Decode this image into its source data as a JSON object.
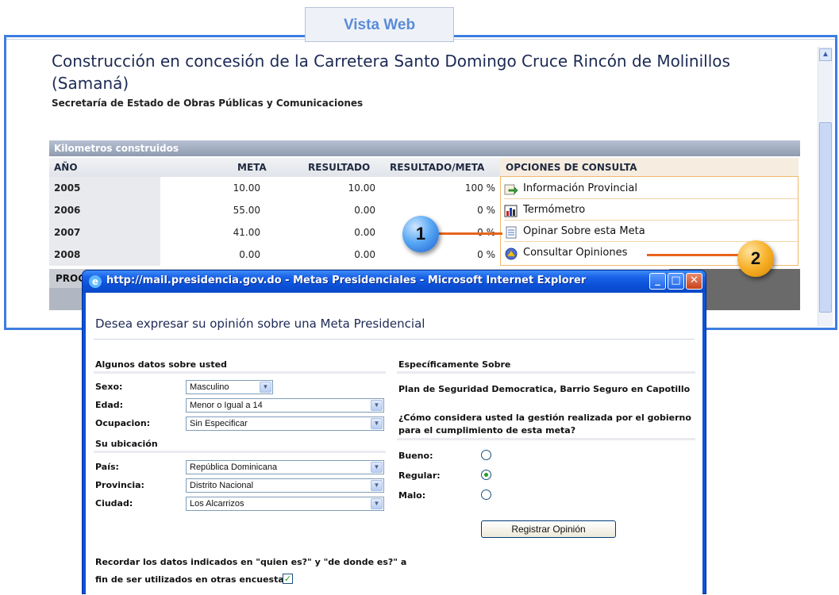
{
  "tab_label": "Vista Web",
  "page": {
    "title": "Construcción en concesión de la Carretera Santo Domingo Cruce Rincón de Molinillos (Samaná)",
    "subtitle": "Secretaría de Estado de Obras Públicas y Comunicaciones"
  },
  "km_table": {
    "caption": "Kilometros construidos",
    "headers": [
      "AÑO",
      "META",
      "RESULTADO",
      "RESULTADO/META"
    ],
    "rows": [
      {
        "year": "2005",
        "meta": "10.00",
        "resultado": "10.00",
        "ratio": "100 %"
      },
      {
        "year": "2006",
        "meta": "55.00",
        "resultado": "0.00",
        "ratio": "0 %"
      },
      {
        "year": "2007",
        "meta": "41.00",
        "resultado": "0.00",
        "ratio": "0 %"
      },
      {
        "year": "2008",
        "meta": "0.00",
        "resultado": "0.00",
        "ratio": "0 %"
      }
    ],
    "prog_label": "PROG"
  },
  "options": {
    "header": "OPCIONES DE CONSULTA",
    "items": [
      {
        "label": "Información Provincial",
        "icon": "info-arrow-icon"
      },
      {
        "label": "Termómetro",
        "icon": "bar-chart-icon"
      },
      {
        "label": "Opinar Sobre esta Meta",
        "icon": "document-icon"
      },
      {
        "label": "Consultar Opiniones",
        "icon": "opinions-icon"
      }
    ]
  },
  "callouts": [
    "1",
    "2"
  ],
  "dialog": {
    "title": "http://mail.presidencia.gov.do - Metas Presidenciales - Microsoft Internet Explorer",
    "heading": "Desea expresar su opinión sobre una Meta Presidencial",
    "about_you": {
      "header": "Algunos datos sobre usted",
      "sexo_label": "Sexo:",
      "sexo_value": "Masculino",
      "edad_label": "Edad:",
      "edad_value": "Menor o Igual a 14",
      "ocupacion_label": "Ocupacion:",
      "ocupacion_value": "Sin Especificar"
    },
    "location": {
      "header": "Su ubicación",
      "pais_label": "País:",
      "pais_value": "República Dominicana",
      "provincia_label": "Provincia:",
      "provincia_value": "Distrito Nacional",
      "ciudad_label": "Ciudad:",
      "ciudad_value": "Los Alcarrizos"
    },
    "specific": {
      "header": "Específicamente Sobre",
      "plan": "Plan de Seguridad Democratica, Barrio Seguro en Capotillo",
      "question_line1": "¿Cómo considera usted la gestión realizada por el gobierno",
      "question_line2": "para el cumplimiento de esta meta?",
      "options": [
        "Bueno:",
        "Regular:",
        "Malo:"
      ],
      "selected": "Regular:",
      "submit": "Registrar Opinión"
    },
    "remember_line1": "Recordar los datos indicados en \"quien es?\" y \"de donde es?\" a",
    "remember_line2": "fin de ser utilizados en otras encuestas",
    "remember_checked": true
  },
  "colors": {
    "frame": "#3d7de0",
    "ie_title": "#0a53d8",
    "callout1": "#1a5fd0",
    "callout2": "#f7b028",
    "connector": "#e8641c"
  }
}
